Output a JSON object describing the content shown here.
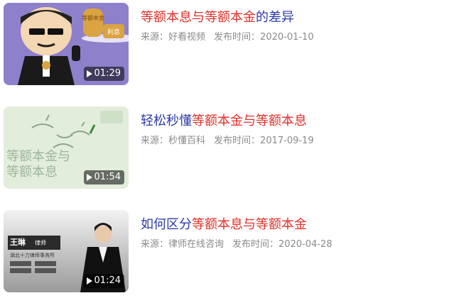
{
  "items": [
    {
      "duration": "01:29",
      "title_plain_before": "",
      "title_highlight": "等额本息与等额本金",
      "title_plain_after": "的差异",
      "source_label": "来源：",
      "source": "好看视频",
      "date_label": "发布时间：",
      "date": "2020-01-10",
      "thumb_text_bag": "等额本金",
      "thumb_text_sign": "利息"
    },
    {
      "duration": "01:54",
      "title_plain_before": "轻松秒懂",
      "title_highlight": "等额本金与等额本息",
      "title_plain_after": "",
      "source_label": "来源：",
      "source": "秒懂百科",
      "date_label": "发布时间：",
      "date": "2017-09-19",
      "thumb_text_line1": "等额本金与",
      "thumb_text_line2": "等额本息"
    },
    {
      "duration": "01:24",
      "title_plain_before": "如何区分",
      "title_highlight": "等额本息与等额本金",
      "title_plain_after": "",
      "source_label": "来源：",
      "source": "律师在线咨询",
      "date_label": "发布时间：",
      "date": "2020-04-28",
      "thumb_name": "王琳",
      "thumb_role": "律师",
      "thumb_firm": "湖北十力律师事务所"
    }
  ],
  "colors": {
    "title_blue": "#2c3aa8",
    "title_highlight_red": "#e0302b",
    "meta_gray": "#8a8a8a"
  }
}
